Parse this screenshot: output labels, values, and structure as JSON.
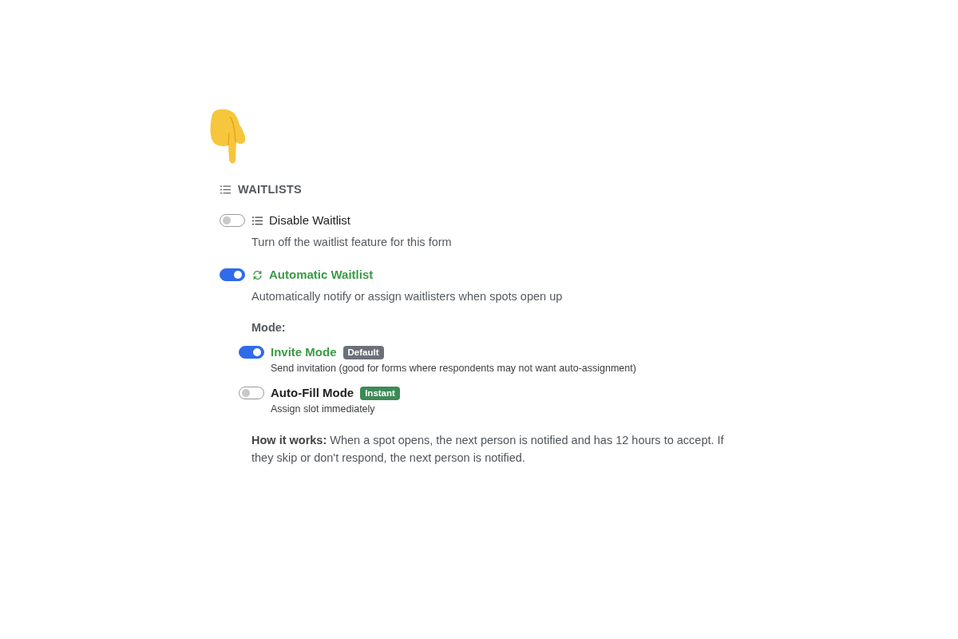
{
  "section": {
    "title": "WAITLISTS"
  },
  "options": [
    {
      "kind": "list",
      "label": "Disable Waitlist",
      "description": "Turn off the waitlist feature for this form",
      "on": false
    },
    {
      "kind": "cycle",
      "label": "Automatic Waitlist",
      "description": "Automatically notify or assign waitlisters when spots open up",
      "on": true,
      "mode_title": "Mode:",
      "modes": [
        {
          "label": "Invite Mode",
          "badge": {
            "text": "Default",
            "color": "#6b7079"
          },
          "description": "Send invitation (good for forms where respondents may not want auto-assignment)",
          "on": true
        },
        {
          "label": "Auto-Fill Mode",
          "badge": {
            "text": "Instant",
            "color": "#3d8a56"
          },
          "description": "Assign slot immediately",
          "on": false
        }
      ],
      "note": "**How it works:** When a spot opens, the next person is notified and has 12 hours to accept. If they skip or don't respond, the next person is notified."
    }
  ]
}
